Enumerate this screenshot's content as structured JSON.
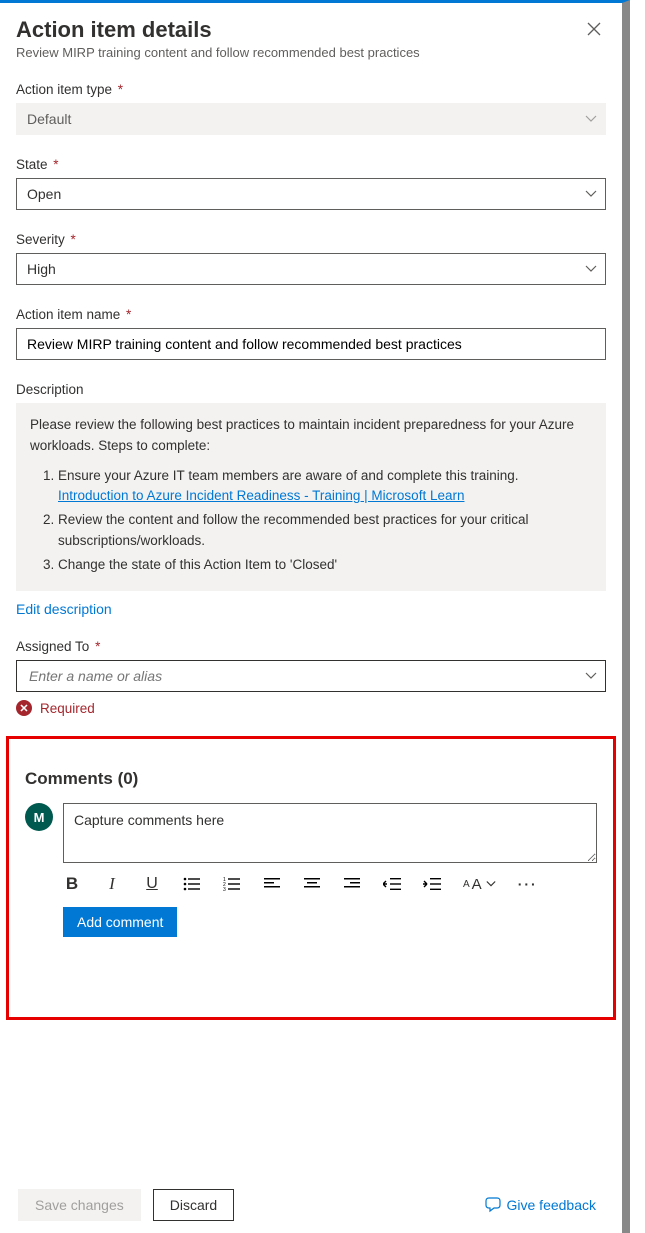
{
  "header": {
    "title": "Action item details",
    "subtitle": "Review MIRP training content and follow recommended best practices"
  },
  "fields": {
    "type": {
      "label": "Action item type",
      "value": "Default"
    },
    "state": {
      "label": "State",
      "value": "Open"
    },
    "severity": {
      "label": "Severity",
      "value": "High"
    },
    "name": {
      "label": "Action item name",
      "value": "Review MIRP training content and follow recommended best practices"
    },
    "description": {
      "label": "Description",
      "intro": "Please review the following best practices to maintain incident preparedness for your Azure workloads. Steps to complete:",
      "steps": {
        "s1": "Ensure your Azure IT team members are aware of and complete this training.",
        "link": "Introduction to Azure Incident Readiness - Training | Microsoft Learn",
        "s2": "Review the content and follow the recommended best practices for your critical subscriptions/workloads.",
        "s3": "Change the state of this Action Item to 'Closed'"
      },
      "edit": "Edit description"
    },
    "assigned": {
      "label": "Assigned To",
      "placeholder": "Enter a name or alias",
      "error": "Required"
    }
  },
  "comments": {
    "title": "Comments (0)",
    "avatar": "M",
    "placeholder": "Capture comments here",
    "add": "Add comment"
  },
  "footer": {
    "save": "Save changes",
    "discard": "Discard",
    "feedback": "Give feedback"
  }
}
